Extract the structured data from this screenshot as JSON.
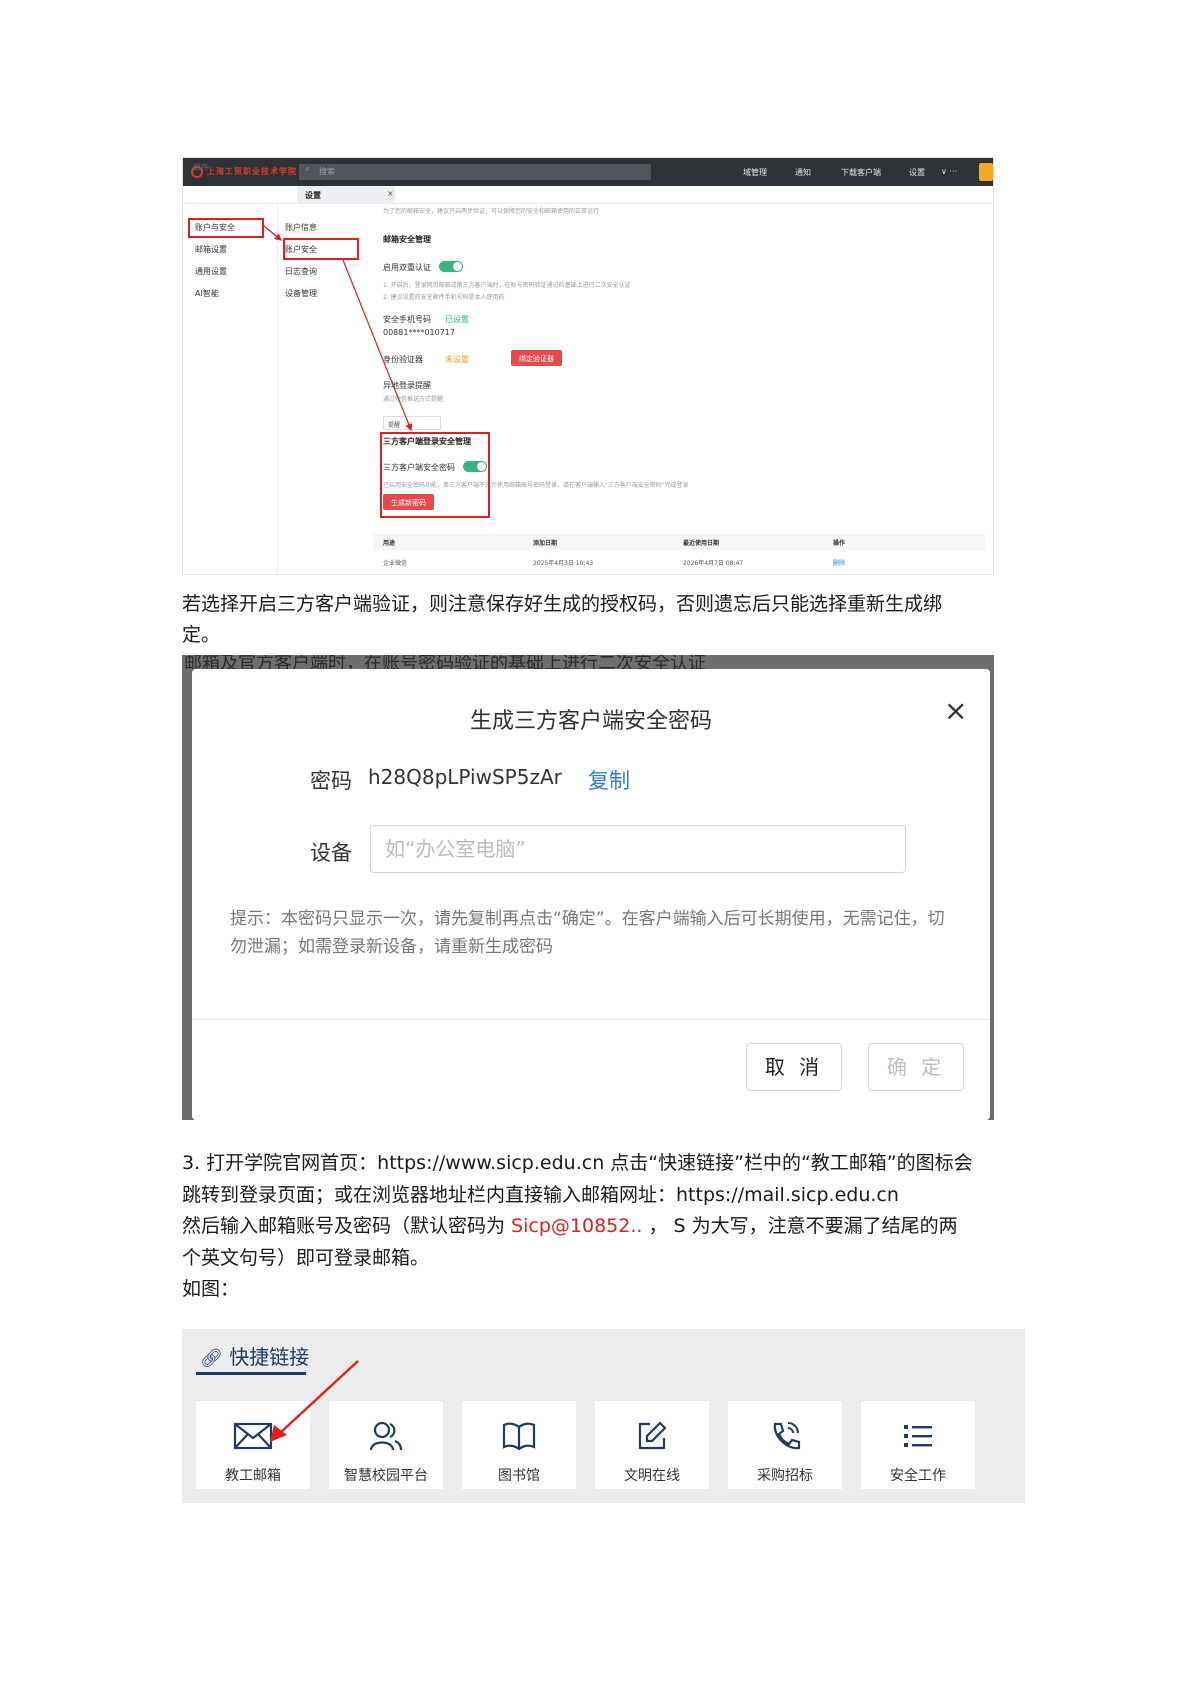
{
  "mail_settings": {
    "logo_text": "上海工贸职业技术学院",
    "search_placeholder": "搜索",
    "top_nav": [
      "域管理",
      "通知",
      "下载客户端",
      "设置"
    ],
    "top_more": "∨  ···",
    "sub_mail": "邮件",
    "tab_label": "设置",
    "tab_close": "×",
    "nav_primary": [
      "账户与安全",
      "邮箱设置",
      "通用设置",
      "AI智能"
    ],
    "nav_secondary": [
      "账户信息",
      "账户安全",
      "日志查询",
      "设备管理"
    ],
    "top_note": "为了您的邮箱安全，建议开启两步验证，可以保障您的安全和邮箱使用的正常运行",
    "section_title": "邮箱安全管理",
    "two_step_label": "启用双重认证",
    "two_step_note1": "1. 开启后，登录网页邮箱或第三方客户端时，在账号密码验证通过的基础上进行二次安全认证",
    "two_step_note2": "2. 建议设置的安全邮件手机号码是本人使用的",
    "phone_label": "安全手机号码",
    "phone_status": "已设置",
    "phone_value": "00881****010717",
    "identity_label": "身份验证器",
    "identity_status": "未设置",
    "identity_button": "绑定验证器",
    "remote_label": "异地登录提醒",
    "remote_note": "通过短信推送方式提醒",
    "remote_select": "提醒",
    "third_title": "三方客户端登录安全管理",
    "third_label": "三方客户端安全密码",
    "third_note": "已启用安全密码功能，第三方客户端不允许使用邮箱账号密码登录，请在客户端输入\"三方客户端安全密码\"完成登录",
    "third_button": "生成新密码",
    "table_headers": [
      "用途",
      "添加日期",
      "最近使用日期",
      "操作"
    ],
    "table_row": [
      "企业微信",
      "2025年4月3日 10:43",
      "2026年4月7日 08:47",
      "删除"
    ]
  },
  "paragraph1": [
    "若选择开启三方客户端验证，则注意保存好生成的授权码，否则遗忘后只能选择重新生成绑",
    "定。"
  ],
  "dialog": {
    "background_text": "邮箱及官方客户端时，在账号密码验证的基础上进行二次安全认证",
    "title": "生成三方客户端安全密码",
    "close": "×",
    "password_label": "密码",
    "password_value": "h28Q8pLPiwSP5zAr",
    "copy_label": "复制",
    "device_label": "设备",
    "device_placeholder": "如“办公室电脑”",
    "hint": "提示：本密码只显示一次，请先复制再点击“确定”。在客户端输入后可长期使用，无需记住，切勿泄漏；如需登录新设备，请重新生成密码",
    "cancel_label": "取 消",
    "confirm_label": "确 定"
  },
  "paragraph2": {
    "line1": "3.  打开学院官网首页：https://www.sicp.edu.cn 点击“快速链接”栏中的“教工邮箱”的图标会",
    "line2": "跳转到登录页面；或在浏览器地址栏内直接输入邮箱网址：https://mail.sicp.edu.cn",
    "line3_pre": "然后输入邮箱账号及密码（默认密码为 ",
    "line3_red": "Sicp@10852..",
    "line3_post": " ， S 为大写，注意不要漏了结尾的两",
    "line4": "个英文句号）即可登录邮箱。",
    "line5": "如图："
  },
  "quick_links": {
    "title": "快捷链接",
    "items": [
      {
        "label": "教工邮箱",
        "icon": "mail-icon"
      },
      {
        "label": "智慧校园平台",
        "icon": "users-icon"
      },
      {
        "label": "图书馆",
        "icon": "book-icon"
      },
      {
        "label": "文明在线",
        "icon": "edit-icon"
      },
      {
        "label": "采购招标",
        "icon": "phone-icon"
      },
      {
        "label": "安全工作",
        "icon": "list-icon"
      }
    ],
    "accent_color": "#1f3b63",
    "arrow_color": "#e02020"
  }
}
